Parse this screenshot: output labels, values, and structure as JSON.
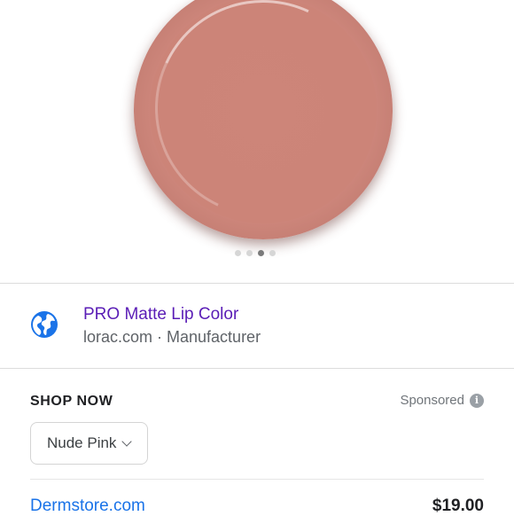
{
  "image_carousel": {
    "swatch_color": "#cc857a",
    "dot_count": 4,
    "active_index": 2
  },
  "source": {
    "title": "PRO Matte Lip Color",
    "subtitle": "lorac.com · Manufacturer",
    "icon": "globe-icon"
  },
  "shop": {
    "label": "SHOP NOW",
    "sponsored": "Sponsored",
    "info_icon": "i",
    "shade_selected": "Nude Pink"
  },
  "offer": {
    "seller": "Dermstore.com",
    "price": "$19.00"
  }
}
